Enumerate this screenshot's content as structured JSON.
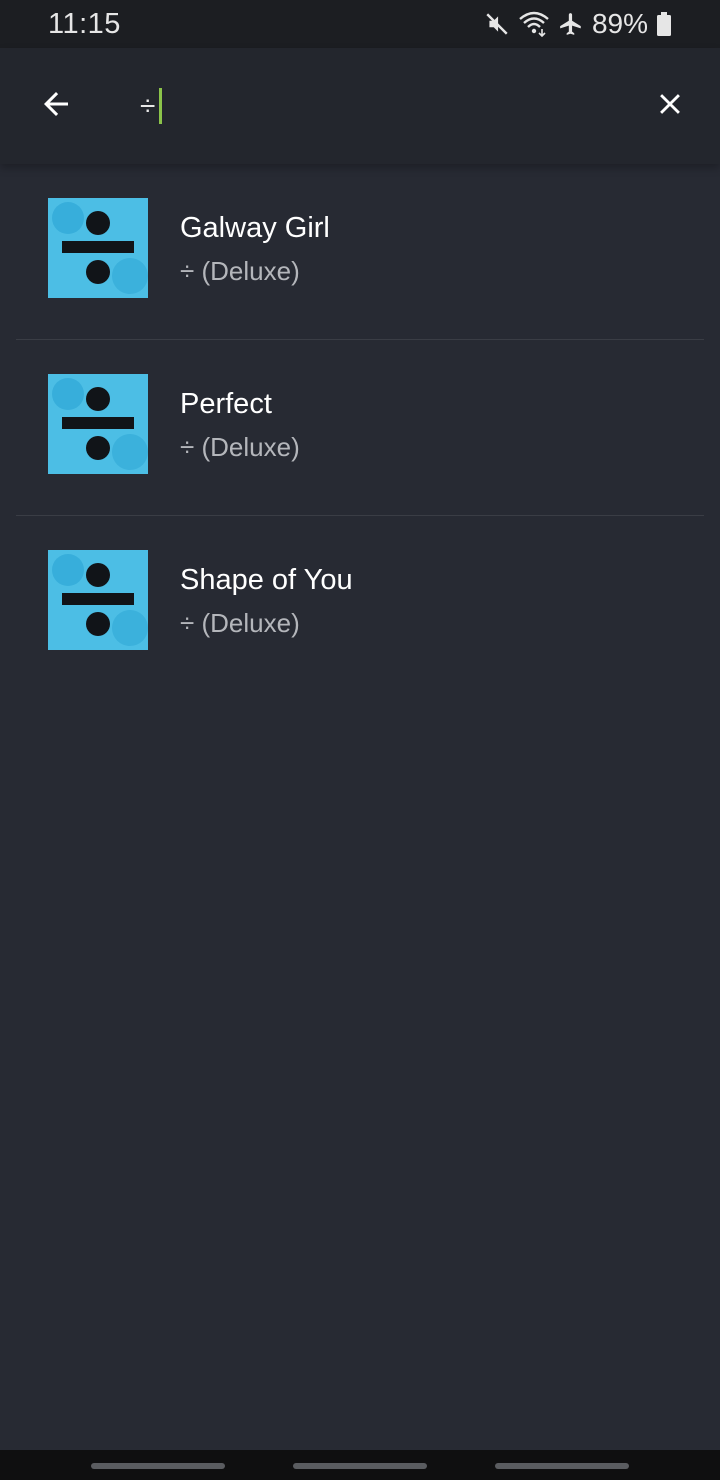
{
  "status_bar": {
    "time": "11:15",
    "battery": "89%",
    "icons": [
      "mute-icon",
      "wifi-icon",
      "airplane-icon",
      "battery-icon"
    ]
  },
  "search": {
    "query": "÷",
    "icons": {
      "back": "arrow-left-icon",
      "clear": "close-icon"
    },
    "caret_color": "#8bc34a"
  },
  "results": [
    {
      "title": "Galway Girl",
      "subtitle": "÷ (Deluxe)"
    },
    {
      "title": "Perfect",
      "subtitle": "÷ (Deluxe)"
    },
    {
      "title": "Shape of You",
      "subtitle": "÷ (Deluxe)"
    }
  ],
  "colors": {
    "background": "#272a33",
    "header": "#23262d",
    "status_bar": "#1c1e22",
    "album_art": "#3fb6e0"
  }
}
